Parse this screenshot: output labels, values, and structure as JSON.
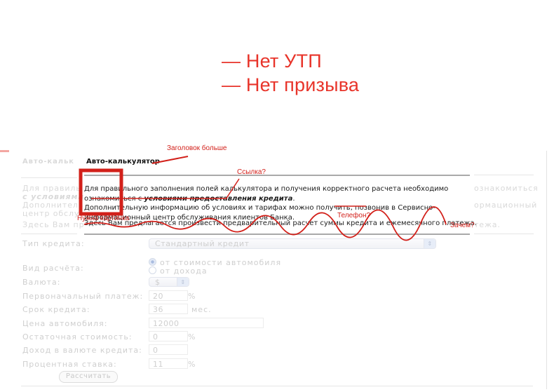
{
  "slide": {
    "headlines": [
      "— Нет УТП",
      "— Нет призыва"
    ]
  },
  "ghost": {
    "title": "Авто-кальк",
    "intro_line1": "Для правиль",
    "intro_line2": "с условиями",
    "intro_line3": "Дополнитель",
    "intro_line4": "центр обслу:",
    "note": "Здесь Вам пр",
    "right1": "ознакомиться",
    "right2": "ормационный",
    "right3": "тежа."
  },
  "panel": {
    "title": "Авто-калькулятор",
    "intro_part1": "Для правильного заполнения полей калькулятора и получения корректного расчета необходимо ознакомиться с ",
    "intro_link": "условиями предоставления кредита",
    "intro_part2": ".",
    "intro_part3": "Дополнительную информацию об условиях и тарифах можно получить, позвонив в Сервисно-информационный центр обслуживания клиентов Банка.",
    "note": "Здесь Вам предлагается произвести предварительный расчет суммы кредита и ежемесячного платежа."
  },
  "form": {
    "credit_type": {
      "label": "Тип кредита:",
      "value": "Стандартный кредит"
    },
    "calc_type": {
      "label": "Вид расчёта:",
      "options": [
        "от стоимости автомобиля",
        "от дохода"
      ],
      "selected": 0
    },
    "currency": {
      "label": "Валюта:",
      "value": "$"
    },
    "down_payment": {
      "label": "Первоначальный платеж:",
      "value": "20",
      "unit": "%"
    },
    "term": {
      "label": "Срок кредита:",
      "value": "36",
      "unit": "мес."
    },
    "car_price": {
      "label": "Цена автомобиля:",
      "value": "12000"
    },
    "residual": {
      "label": "Остаточная стоимость:",
      "value": "0",
      "unit": "%"
    },
    "income": {
      "label": "Доход в валюте кредита:",
      "value": "0"
    },
    "rate": {
      "label": "Процентная ставка:",
      "value": "11",
      "unit": "%"
    },
    "submit_label": "Рассчитать"
  },
  "annotations": {
    "header_bigger": "Заголовок больше",
    "link_q": "Ссылка?",
    "need_picture": "Нужна картинка",
    "phone_q": "Телефон?",
    "why_q": "Зачем?",
    "color": "#d2201a"
  }
}
